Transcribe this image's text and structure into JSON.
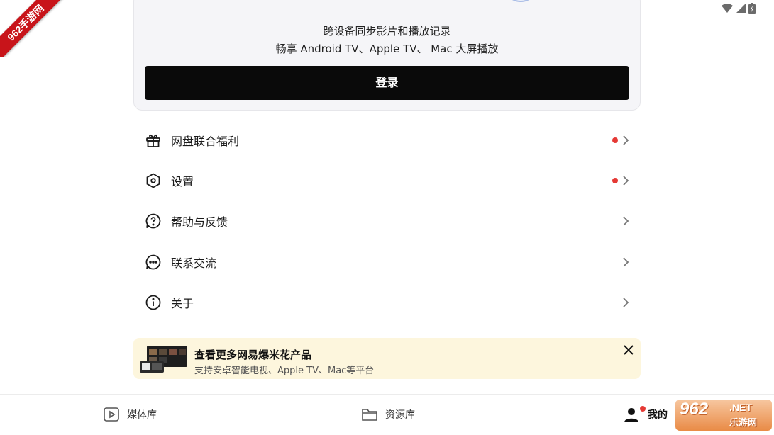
{
  "watermark": {
    "ribbon_text": "962手游网",
    "logo_number": "962",
    "logo_net": ".NET",
    "logo_sub": "乐游网"
  },
  "login_card": {
    "line1": "跨设备同步影片和播放记录",
    "line2": "畅享 Android TV、Apple TV、 Mac 大屏播放",
    "login_label": "登录"
  },
  "menu": {
    "items": [
      {
        "label": "网盘联合福利",
        "icon": "gift-icon",
        "has_dot": true
      },
      {
        "label": "设置",
        "icon": "settings-hexagon-icon",
        "has_dot": true
      },
      {
        "label": "帮助与反馈",
        "icon": "help-bubble-icon",
        "has_dot": false
      },
      {
        "label": "联系交流",
        "icon": "chat-bubble-icon",
        "has_dot": false
      },
      {
        "label": "关于",
        "icon": "info-icon",
        "has_dot": false
      }
    ]
  },
  "promo": {
    "title": "查看更多网易爆米花产品",
    "subtitle": "支持安卓智能电视、Apple TV、Mac等平台"
  },
  "bottom_nav": {
    "tabs": [
      {
        "label": "媒体库",
        "icon": "play-box-icon",
        "active": false
      },
      {
        "label": "资源库",
        "icon": "folder-icon",
        "active": false
      },
      {
        "label": "我的",
        "icon": "person-icon",
        "active": true
      }
    ]
  },
  "colors": {
    "accent_dot": "#e53935",
    "login_button": "#0a0a0a",
    "promo_bg": "#fdf6dd",
    "card_bg": "#f5f5f8"
  }
}
